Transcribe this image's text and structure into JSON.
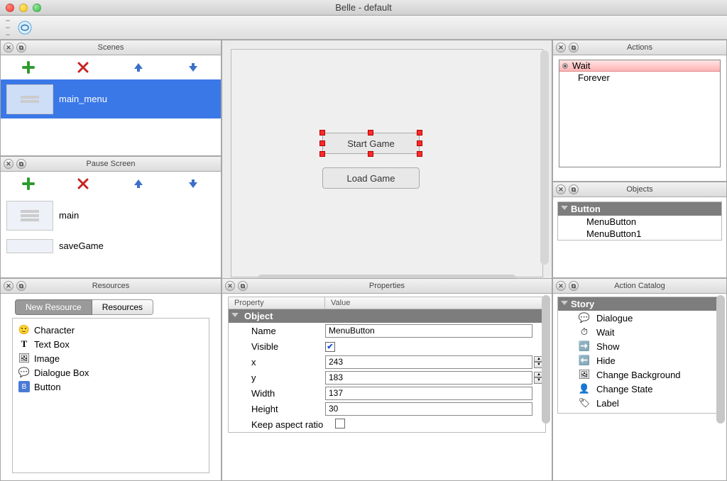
{
  "window_title": "Belle - default",
  "panels": {
    "scenes": {
      "title": "Scenes",
      "items": [
        "main_menu"
      ],
      "selected": 0
    },
    "pause": {
      "title": "Pause Screen",
      "items": [
        "main",
        "saveGame"
      ]
    },
    "resources": {
      "title": "Resources",
      "tabs": [
        "New Resource",
        "Resources"
      ],
      "active_tab": 0,
      "items": [
        "Character",
        "Text Box",
        "Image",
        "Dialogue Box",
        "Button"
      ]
    },
    "canvas": {
      "buttons": [
        "Start Game",
        "Load Game"
      ],
      "selected": 0
    },
    "actions": {
      "title": "Actions",
      "items": [
        "Wait",
        "Forever"
      ]
    },
    "objects": {
      "title": "Objects",
      "header": "Button",
      "items": [
        "MenuButton",
        "MenuButton1"
      ]
    },
    "properties": {
      "title": "Properties",
      "columns": [
        "Property",
        "Value"
      ],
      "section": "Object",
      "rows": {
        "name_label": "Name",
        "name_value": "MenuButton",
        "visible_label": "Visible",
        "visible_value": true,
        "x_label": "x",
        "x_value": "243",
        "y_label": "y",
        "y_value": "183",
        "width_label": "Width",
        "width_value": "137",
        "height_label": "Height",
        "height_value": "30",
        "keep_label": "Keep aspect ratio",
        "keep_value": false
      }
    },
    "catalog": {
      "title": "Action Catalog",
      "section": "Story",
      "items": [
        "Dialogue",
        "Wait",
        "Show",
        "Hide",
        "Change Background",
        "Change State",
        "Label"
      ]
    }
  }
}
